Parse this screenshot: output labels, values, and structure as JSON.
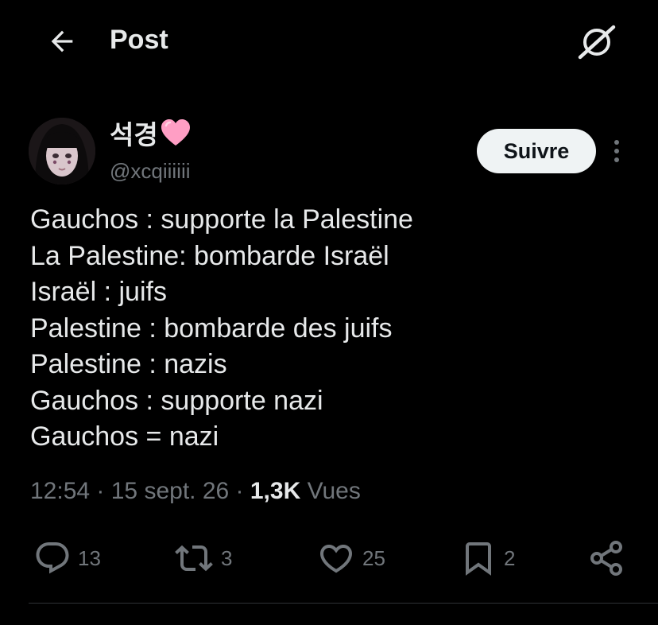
{
  "header": {
    "title": "Post",
    "back_icon": "arrow-left-icon",
    "grok_icon": "grok-icon"
  },
  "author": {
    "display_name": "석경",
    "name_emoji": "pink-heart",
    "handle": "@xcqiiiiii",
    "follow_label": "Suivre",
    "more_icon": "more-vertical-icon"
  },
  "tweet": {
    "lines": [
      "Gauchos : supporte la Palestine",
      "La Palestine: bombarde Israël",
      "Israël : juifs",
      "Palestine : bombarde des juifs",
      "Palestine : nazis",
      "Gauchos : supporte nazi",
      "Gauchos = nazi"
    ]
  },
  "meta": {
    "time": "12:54",
    "date": "15 sept. 26",
    "views_count": "1,3K",
    "views_label": "Vues"
  },
  "actions": {
    "replies": "13",
    "reposts": "3",
    "likes": "25",
    "bookmarks": "2"
  },
  "colors": {
    "background": "#000000",
    "text": "#e7e9ea",
    "muted": "#71767b",
    "follow_bg": "#eff3f4",
    "divider": "#2f3336",
    "heart": "#ff9ec4"
  }
}
